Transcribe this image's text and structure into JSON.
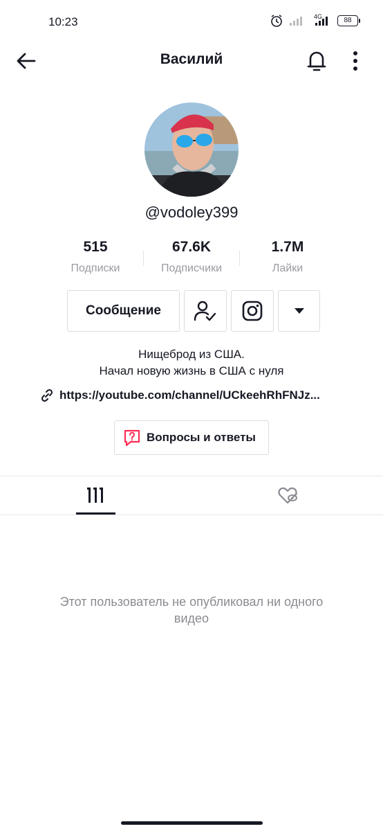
{
  "status_bar": {
    "time": "10:23",
    "network": "4G",
    "battery": "88"
  },
  "header": {
    "title": "Василий"
  },
  "profile": {
    "username": "@vodoley399"
  },
  "stats": [
    {
      "value": "515",
      "label": "Подписки"
    },
    {
      "value": "67.6K",
      "label": "Подписчики"
    },
    {
      "value": "1.7M",
      "label": "Лайки"
    }
  ],
  "actions": {
    "message_label": "Сообщение"
  },
  "bio": {
    "line1": "Нищеброд из США.",
    "line2": "Начал новую жизнь в США с нуля",
    "link": "https://youtube.com/channel/UCkeehRhFNJz..."
  },
  "qa": {
    "label": "Вопросы и ответы"
  },
  "empty_state": {
    "line1": "Этот пользователь не опубликовал ни одного",
    "line2": "видео"
  },
  "colors": {
    "text": "#161823",
    "secondary": "#9a9aa0",
    "accent": "#fe2c55"
  },
  "icons": [
    "back-arrow-icon",
    "bell-icon",
    "more-vertical-icon",
    "user-check-icon",
    "instagram-icon",
    "caret-down-icon",
    "link-icon",
    "question-bubble-icon",
    "grid-icon",
    "heart-lock-icon"
  ]
}
